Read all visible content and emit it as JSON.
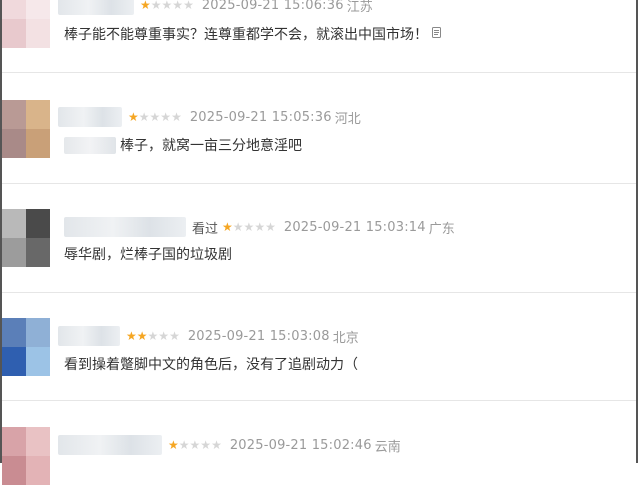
{
  "reviews": [
    {
      "watched": "",
      "stars": 1,
      "time": "2025-09-21 15:06:36",
      "location": "江苏",
      "content": "棒子能不能尊重事实？连尊重都学不会，就滚出中国市场！",
      "avatar_colors": [
        "#f0d9dc",
        "#f6e8ea",
        "#e8c9cd",
        "#f3e1e3"
      ]
    },
    {
      "watched": "",
      "stars": 1,
      "time": "2025-09-21 15:05:36",
      "location": "河北",
      "content": "棒子，就窝一亩三分地意淫吧",
      "avatar_colors": [
        "#b99a95",
        "#d9b48a",
        "#a98a88",
        "#c9a078"
      ]
    },
    {
      "watched": "看过",
      "stars": 1,
      "time": "2025-09-21 15:03:14",
      "location": "广东",
      "content": "辱华剧，烂棒子国的垃圾剧",
      "avatar_colors": [
        "#b9b9b9",
        "#4a4a4a",
        "#9c9c9c",
        "#686868"
      ]
    },
    {
      "watched": "",
      "stars": 2,
      "time": "2025-09-21 15:03:08",
      "location": "北京",
      "content": "看到操着蹩脚中文的角色后，没有了追剧动力（",
      "avatar_colors": [
        "#5b7fb8",
        "#8fb0d6",
        "#2f5fb0",
        "#9cc3e6"
      ]
    },
    {
      "watched": "",
      "stars": 1,
      "time": "2025-09-21 15:02:46",
      "location": "云南",
      "content": "",
      "avatar_colors": [
        "#d8a3a8",
        "#e9c2c4",
        "#c98c92",
        "#e3b3b6"
      ]
    }
  ]
}
